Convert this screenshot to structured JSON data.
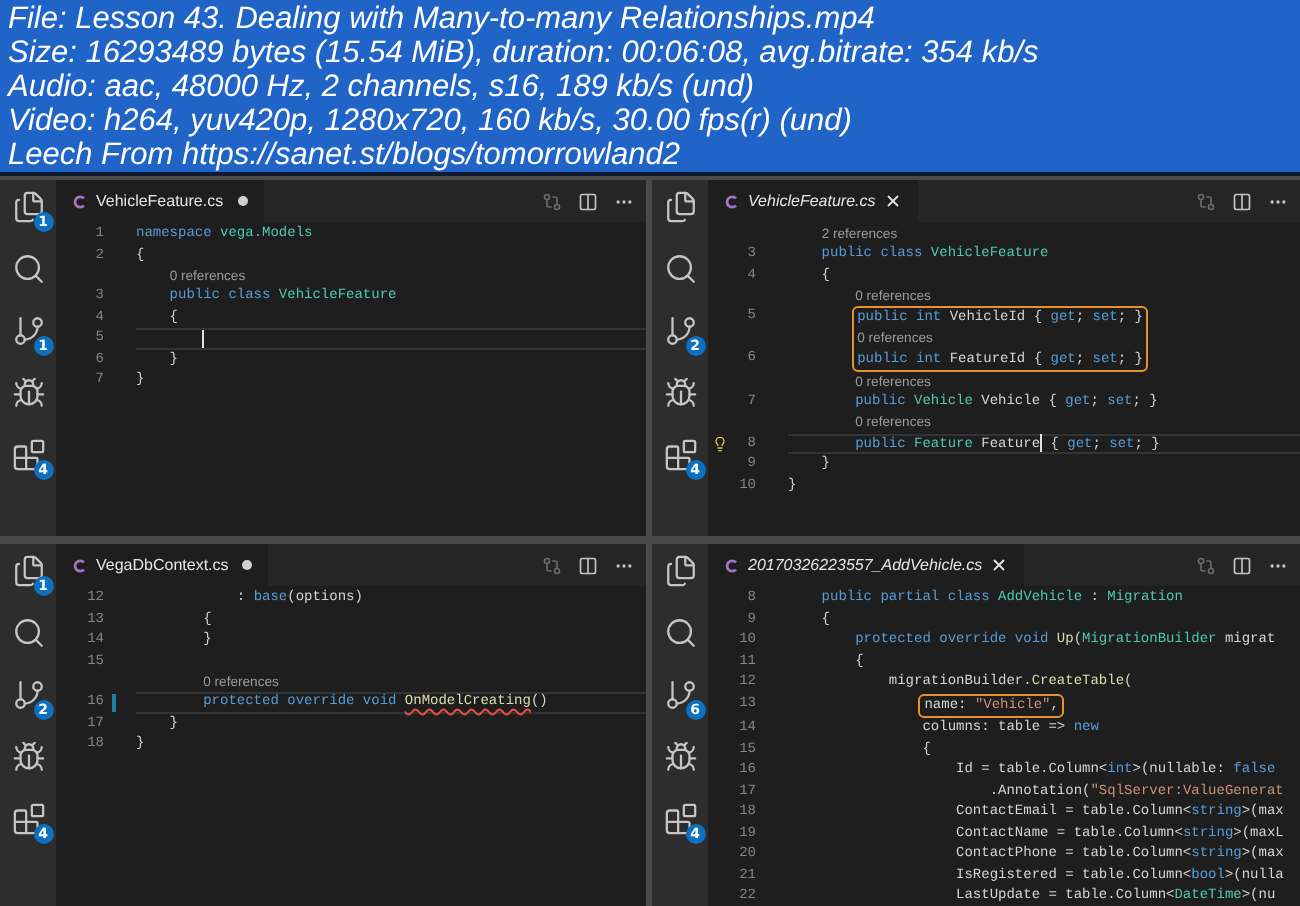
{
  "header": {
    "lines": [
      "File: Lesson 43. Dealing with Many-to-many Relationships.mp4",
      "Size: 16293489 bytes (15.54 MiB), duration: 00:06:08, avg.bitrate: 354 kb/s",
      "Audio: aac, 48000 Hz, 2 channels, s16, 189 kb/s (und)",
      "Video: h264, yuv420p, 1280x720, 160 kb/s, 30.00 fps(r) (und)",
      "Leech From https://sanet.st/blogs/tomorrowland2"
    ]
  },
  "frames": [
    {
      "activity_badges": {
        "files": "1",
        "git": "1",
        "extensions": "4"
      },
      "tab": {
        "title": "VehicleFeature.cs",
        "preview": false,
        "modified": true
      },
      "lines": [
        {
          "kind": "code",
          "number": "1",
          "current": false,
          "boxed": false,
          "segments": [
            {
              "text": "namespace ",
              "kind": "kw"
            },
            {
              "text": "vega.Models",
              "kind": "type"
            }
          ]
        },
        {
          "kind": "code",
          "number": "2",
          "current": false,
          "boxed": false,
          "segments": [
            {
              "text": "{",
              "kind": "plain"
            }
          ]
        },
        {
          "kind": "lens",
          "text": "    0 references",
          "boxed": false
        },
        {
          "kind": "code",
          "number": "3",
          "current": false,
          "boxed": false,
          "segments": [
            {
              "text": "    public class ",
              "kind": "kw"
            },
            {
              "text": "VehicleFeature",
              "kind": "type"
            }
          ]
        },
        {
          "kind": "code",
          "number": "4",
          "current": false,
          "boxed": false,
          "segments": [
            {
              "text": "    {",
              "kind": "plain"
            }
          ]
        },
        {
          "kind": "code",
          "number": "5",
          "current": true,
          "boxed": false,
          "caret": true
        },
        {
          "kind": "code",
          "number": "6",
          "current": false,
          "boxed": false,
          "segments": [
            {
              "text": "    }",
              "kind": "plain"
            }
          ]
        },
        {
          "kind": "code",
          "number": "7",
          "current": false,
          "boxed": false,
          "segments": [
            {
              "text": "}",
              "kind": "plain"
            }
          ]
        }
      ]
    },
    {
      "activity_badges": {
        "git": "2",
        "extensions": "4"
      },
      "tab": {
        "title": "VehicleFeature.cs",
        "preview": true,
        "modified": false
      },
      "lines": [
        {
          "kind": "lens",
          "text": "    2 references",
          "boxed": false
        },
        {
          "kind": "code",
          "number": "3",
          "current": false,
          "boxed": false,
          "segments": [
            {
              "text": "    public class ",
              "kind": "kw"
            },
            {
              "text": "VehicleFeature",
              "kind": "type"
            }
          ]
        },
        {
          "kind": "code",
          "number": "4",
          "current": false,
          "boxed": false,
          "segments": [
            {
              "text": "    {",
              "kind": "plain"
            }
          ]
        },
        {
          "kind": "lens",
          "text": "        0 references",
          "boxed": false
        },
        {
          "kind": "code",
          "number": "5",
          "current": false,
          "boxed": true,
          "segments": [
            {
              "text": "        public int ",
              "kind": "kw"
            },
            {
              "text": "VehicleId { ",
              "kind": "plain"
            },
            {
              "text": "get",
              "kind": "kw"
            },
            {
              "text": "; ",
              "kind": "plain"
            },
            {
              "text": "set",
              "kind": "kw"
            },
            {
              "text": "; }",
              "kind": "plain"
            }
          ]
        },
        {
          "kind": "lens",
          "text": "        0 references",
          "boxed": true
        },
        {
          "kind": "code",
          "number": "6",
          "current": false,
          "boxed": true,
          "segments": [
            {
              "text": "        public int ",
              "kind": "kw"
            },
            {
              "text": "FeatureId { ",
              "kind": "plain"
            },
            {
              "text": "get",
              "kind": "kw"
            },
            {
              "text": "; ",
              "kind": "plain"
            },
            {
              "text": "set",
              "kind": "kw"
            },
            {
              "text": "; }",
              "kind": "plain"
            }
          ]
        },
        {
          "kind": "lens",
          "text": "        0 references",
          "boxed": false
        },
        {
          "kind": "code",
          "number": "7",
          "current": false,
          "boxed": false,
          "segments": [
            {
              "text": "        public ",
              "kind": "kw"
            },
            {
              "text": "Vehicle",
              "kind": "type"
            },
            {
              "text": " Vehicle { ",
              "kind": "plain"
            },
            {
              "text": "get",
              "kind": "kw"
            },
            {
              "text": "; ",
              "kind": "plain"
            },
            {
              "text": "set",
              "kind": "kw"
            },
            {
              "text": "; }",
              "kind": "plain"
            }
          ]
        },
        {
          "kind": "lens",
          "text": "        0 references",
          "boxed": false
        },
        {
          "kind": "code",
          "number": "8",
          "current": true,
          "boxed": false,
          "lightbulb": true,
          "segments": [
            {
              "text": "        public ",
              "kind": "kw"
            },
            {
              "text": "Feature",
              "kind": "type"
            },
            {
              "text": " Feature",
              "kind": "plain",
              "caret": true
            },
            {
              "text": " { ",
              "kind": "plain"
            },
            {
              "text": "get",
              "kind": "kw"
            },
            {
              "text": "; ",
              "kind": "plain"
            },
            {
              "text": "set",
              "kind": "kw"
            },
            {
              "text": "; }",
              "kind": "plain"
            }
          ]
        },
        {
          "kind": "code",
          "number": "9",
          "current": false,
          "boxed": false,
          "segments": [
            {
              "text": "    }",
              "kind": "plain"
            }
          ]
        },
        {
          "kind": "code",
          "number": "10",
          "current": false,
          "boxed": false,
          "segments": [
            {
              "text": "}",
              "kind": "plain"
            }
          ]
        }
      ]
    },
    {
      "activity_badges": {
        "files": "1",
        "git": "2",
        "extensions": "4"
      },
      "tab": {
        "title": "VegaDbContext.cs",
        "preview": false,
        "modified": true
      },
      "lines": [
        {
          "kind": "code",
          "number": "12",
          "current": false,
          "boxed": false,
          "segments": [
            {
              "text": "            : ",
              "kind": "plain"
            },
            {
              "text": "base",
              "kind": "kw"
            },
            {
              "text": "(options)",
              "kind": "plain"
            }
          ]
        },
        {
          "kind": "code",
          "number": "13",
          "current": false,
          "boxed": false,
          "segments": [
            {
              "text": "        {",
              "kind": "plain"
            }
          ]
        },
        {
          "kind": "code",
          "number": "14",
          "current": false,
          "boxed": false,
          "segments": [
            {
              "text": "        }",
              "kind": "plain"
            }
          ]
        },
        {
          "kind": "code",
          "number": "15",
          "current": false,
          "boxed": false
        },
        {
          "kind": "lens",
          "text": "        0 references",
          "boxed": false
        },
        {
          "kind": "code",
          "number": "16",
          "current": true,
          "boxed": false,
          "changed": true,
          "segments": [
            {
              "text": "        protected override void ",
              "kind": "kw"
            },
            {
              "text": "OnModelCreating",
              "kind": "fn",
              "error": true
            },
            {
              "text": "()",
              "kind": "plain"
            }
          ]
        },
        {
          "kind": "code",
          "number": "17",
          "current": false,
          "boxed": false,
          "segments": [
            {
              "text": "    }",
              "kind": "plain"
            }
          ]
        },
        {
          "kind": "code",
          "number": "18",
          "current": false,
          "boxed": false,
          "segments": [
            {
              "text": "}",
              "kind": "plain"
            }
          ]
        }
      ]
    },
    {
      "activity_badges": {
        "git": "6",
        "extensions": "4"
      },
      "tab": {
        "title": "20170326223557_AddVehicle.cs",
        "preview": true,
        "modified": false
      },
      "lines": [
        {
          "kind": "code",
          "number": "8",
          "current": false,
          "boxed": false,
          "segments": [
            {
              "text": "    public partial class ",
              "kind": "kw"
            },
            {
              "text": "AddVehicle",
              "kind": "type"
            },
            {
              "text": " : ",
              "kind": "plain"
            },
            {
              "text": "Migration",
              "kind": "type"
            }
          ]
        },
        {
          "kind": "code",
          "number": "9",
          "current": false,
          "boxed": false,
          "segments": [
            {
              "text": "    {",
              "kind": "plain"
            }
          ]
        },
        {
          "kind": "code",
          "number": "10",
          "current": false,
          "boxed": false,
          "segments": [
            {
              "text": "        protected override void ",
              "kind": "kw"
            },
            {
              "text": "Up",
              "kind": "fn"
            },
            {
              "text": "(",
              "kind": "plain"
            },
            {
              "text": "MigrationBuilder",
              "kind": "type"
            },
            {
              "text": " migrat",
              "kind": "plain"
            }
          ]
        },
        {
          "kind": "code",
          "number": "11",
          "current": false,
          "boxed": false,
          "segments": [
            {
              "text": "        {",
              "kind": "plain"
            }
          ]
        },
        {
          "kind": "code",
          "number": "12",
          "current": false,
          "boxed": false,
          "segments": [
            {
              "text": "            migrationBuilder.",
              "kind": "plain"
            },
            {
              "text": "CreateTable",
              "kind": "fn"
            },
            {
              "text": "(",
              "kind": "plain"
            }
          ]
        },
        {
          "kind": "code",
          "number": "13",
          "current": false,
          "boxed": true,
          "segments": [
            {
              "text": "                name: ",
              "kind": "plain"
            },
            {
              "text": "\"Vehicle\"",
              "kind": "str"
            },
            {
              "text": ",",
              "kind": "plain"
            }
          ]
        },
        {
          "kind": "code",
          "number": "14",
          "current": false,
          "boxed": false,
          "segments": [
            {
              "text": "                columns: table => ",
              "kind": "plain"
            },
            {
              "text": "new",
              "kind": "kw"
            }
          ]
        },
        {
          "kind": "code",
          "number": "15",
          "current": false,
          "boxed": false,
          "segments": [
            {
              "text": "                {",
              "kind": "plain"
            }
          ]
        },
        {
          "kind": "code",
          "number": "16",
          "current": false,
          "boxed": false,
          "segments": [
            {
              "text": "                    Id = table.Column<",
              "kind": "plain"
            },
            {
              "text": "int",
              "kind": "kw"
            },
            {
              "text": ">(nullable: ",
              "kind": "plain"
            },
            {
              "text": "false",
              "kind": "kw"
            }
          ]
        },
        {
          "kind": "code",
          "number": "17",
          "current": false,
          "boxed": false,
          "segments": [
            {
              "text": "                        .Annotation(",
              "kind": "plain"
            },
            {
              "text": "\"SqlServer:ValueGenerat",
              "kind": "str"
            }
          ]
        },
        {
          "kind": "code",
          "number": "18",
          "current": false,
          "boxed": false,
          "segments": [
            {
              "text": "                    ContactEmail = table.Column<",
              "kind": "plain"
            },
            {
              "text": "string",
              "kind": "kw"
            },
            {
              "text": ">(max",
              "kind": "plain"
            }
          ]
        },
        {
          "kind": "code",
          "number": "19",
          "current": false,
          "boxed": false,
          "segments": [
            {
              "text": "                    ContactName = table.Column<",
              "kind": "plain"
            },
            {
              "text": "string",
              "kind": "kw"
            },
            {
              "text": ">(maxL",
              "kind": "plain"
            }
          ]
        },
        {
          "kind": "code",
          "number": "20",
          "current": false,
          "boxed": false,
          "segments": [
            {
              "text": "                    ContactPhone = table.Column<",
              "kind": "plain"
            },
            {
              "text": "string",
              "kind": "kw"
            },
            {
              "text": ">(max",
              "kind": "plain"
            }
          ]
        },
        {
          "kind": "code",
          "number": "21",
          "current": false,
          "boxed": false,
          "segments": [
            {
              "text": "                    IsRegistered = table.Column<",
              "kind": "plain"
            },
            {
              "text": "bool",
              "kind": "kw"
            },
            {
              "text": ">(nulla",
              "kind": "plain"
            }
          ]
        },
        {
          "kind": "code",
          "number": "22",
          "current": false,
          "boxed": false,
          "segments": [
            {
              "text": "                    LastUpdate = table.Column<",
              "kind": "plain"
            },
            {
              "text": "DateTime",
              "kind": "type"
            },
            {
              "text": ">(nu",
              "kind": "plain"
            }
          ]
        }
      ]
    }
  ]
}
